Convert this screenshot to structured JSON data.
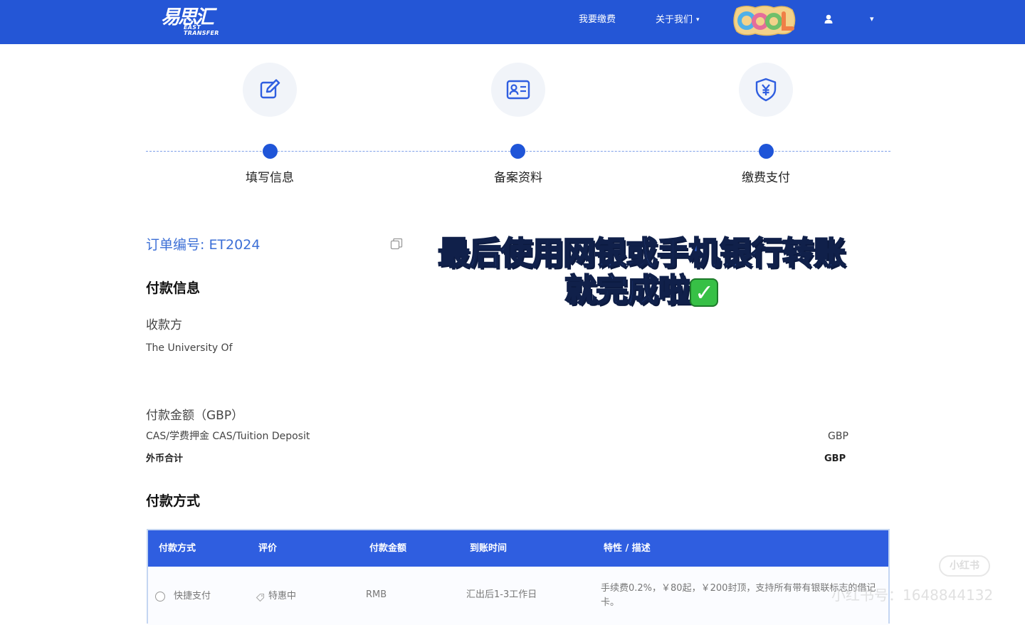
{
  "header": {
    "logo_cn": "易思汇",
    "logo_en": "EAST TRANSFER",
    "nav": [
      {
        "label": "我要缴费"
      },
      {
        "label": "关于我们"
      }
    ],
    "about_caret": "▾",
    "sticker_text": "COOL",
    "user_caret": "▾"
  },
  "steps": [
    {
      "label": "填写信息",
      "icon": "edit-icon"
    },
    {
      "label": "备案资料",
      "icon": "id-card-icon"
    },
    {
      "label": "缴费支付",
      "icon": "yuan-shield-icon"
    }
  ],
  "order": {
    "number_text": "订单编号: ET2024"
  },
  "overlay": {
    "line1": "最后使用网银或手机银行转账",
    "line2": "就完成啦",
    "check": "✓"
  },
  "payment_info": {
    "heading": "付款信息",
    "payee_label": "收款方",
    "payee_value": "The University Of",
    "amount_label": "付款金额（GBP）",
    "item_label": "CAS/学费押金 CAS/Tuition Deposit",
    "item_currency": "GBP",
    "total_label": "外币合计",
    "total_currency": "GBP"
  },
  "payment_method": {
    "heading": "付款方式",
    "columns": [
      "付款方式",
      "评价",
      "付款金额",
      "到账时间",
      "特性 / 描述"
    ],
    "rows": [
      {
        "method": "快捷支付",
        "rating": "特惠中",
        "amount": "RMB",
        "arrival": "汇出后1-3工作日",
        "description": "手续费0.2%，￥80起，￥200封顶，支持所有带有银联标志的借记卡。"
      }
    ]
  },
  "watermark": {
    "badge": "小红书",
    "id_text": "小红书号：1648844132"
  },
  "colors": {
    "brand_blue": "#2456d6",
    "table_header": "#2f5ee0",
    "link_blue": "#3c6fd6"
  }
}
